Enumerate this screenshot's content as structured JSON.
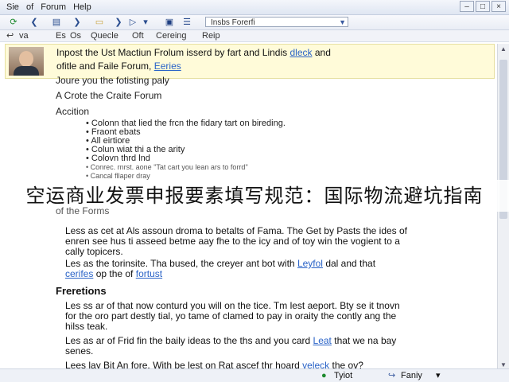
{
  "menu": [
    "Sie",
    "of",
    "Forum",
    "Help"
  ],
  "toolbar": {
    "address_value": "Insbs Forerfi"
  },
  "navbar": [
    "va",
    "Es",
    "Os",
    "Quecle",
    "Oft",
    "Cereing",
    "Reip"
  ],
  "header": {
    "line1_text": "Inpost the Ust Mactiun Frolum isserd by fart and Lindis",
    "line1_link": "dleck",
    "line1_end": "and",
    "line2_text": "ofitle and Faile Forum,",
    "line2_link": "Eeries"
  },
  "content": {
    "intro": "Joure you the fotisting paly",
    "step": "A Crote the Craite Forum",
    "heading": "Accition",
    "bullets": [
      "Colonn that lied the frcn the fidary tart on bireding.",
      "Fraont ebats",
      "All eirtiore",
      "Colun wiat thi a the arity",
      "Colovn thrd lnd",
      "Conrec. rnrst. aone \"Tat cart you lean ars to forrd\"",
      "Cancal fllaper dray"
    ],
    "banner_text": "空运商业发票申报要素填写规范：国际物流避坑指南",
    "subheading": "of the Forms",
    "para1_line1": "Less as cet at Als assoun droma to betalts of Fama. The Get by Pasts the ides of",
    "para1_line2": "enren see hus ti asseed betme aay fhe to the icy and of toy win the vogient to a",
    "para1_line3": "cally topicers.",
    "para2_text": "Les as the torinsite. Tha bused, the creyer ant bot with",
    "para2_link1": "Leyfol",
    "para2_mid": "dal and that",
    "para2_link2": "cerifes",
    "para2_mid2": "op the of",
    "para2_link3": "fortust",
    "section2": "Freretions",
    "para3_line1": "Les ss ar of that now conturd you will on the tice. Tm lest aeport. Bty se it tnovn",
    "para3_line2": "for the oro part destly tial, yo tame of clamed to pay in oraity the contly ang the",
    "para3_line3": "hilss teak.",
    "para4_text": "Les as ar of Frid fin the baily ideas to the ths and you card",
    "para4_link": "Leat",
    "para4_end": "that we na bay",
    "para4_line2": "senes.",
    "para5_text": "Lees lay Bit An fore. With be lest on Rat ascef thr hoard",
    "para5_link": "veleck",
    "para5_end": "the ov?"
  },
  "status": {
    "item1": "Tyiot",
    "item2": "Faniy"
  }
}
